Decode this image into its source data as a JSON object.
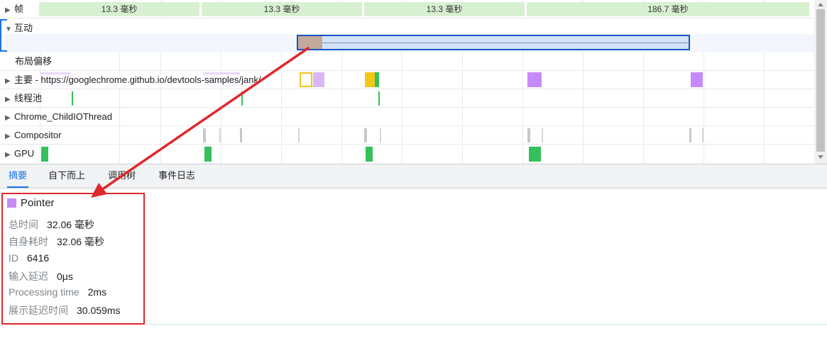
{
  "frames": {
    "label": "帧",
    "segments": [
      "13.3 毫秒",
      "13.3 毫秒",
      "13.3 毫秒",
      "186.7 毫秒"
    ]
  },
  "tracks": {
    "interactions": "互动",
    "layout_shifts": "布局偏移",
    "main": "主要 - https://googlechrome.github.io/devtools-samples/jank/",
    "thread_pool": "线程池",
    "child_io": "Chrome_ChildIOThread",
    "compositor": "Compositor",
    "gpu": "GPU"
  },
  "tabs": [
    "摘要",
    "自下而上",
    "调用树",
    "事件日志"
  ],
  "summary": {
    "title": "Pointer",
    "swatch_color": "#c58af9",
    "rows": [
      {
        "key": "总时间",
        "value": "32.06 毫秒"
      },
      {
        "key": "自身耗时",
        "value": "32.06 毫秒"
      },
      {
        "key": "ID",
        "value": "6416"
      },
      {
        "key": "输入延迟",
        "value": "0μs"
      },
      {
        "key": "Processing time",
        "value": "2ms"
      },
      {
        "key": "展示延迟时间",
        "value": "30.059ms"
      }
    ]
  },
  "colors": {
    "accent": "#1a73e8",
    "annotation": "#e0282c",
    "frame_green": "#d7f0d1",
    "gpu_green": "#34c05a"
  }
}
